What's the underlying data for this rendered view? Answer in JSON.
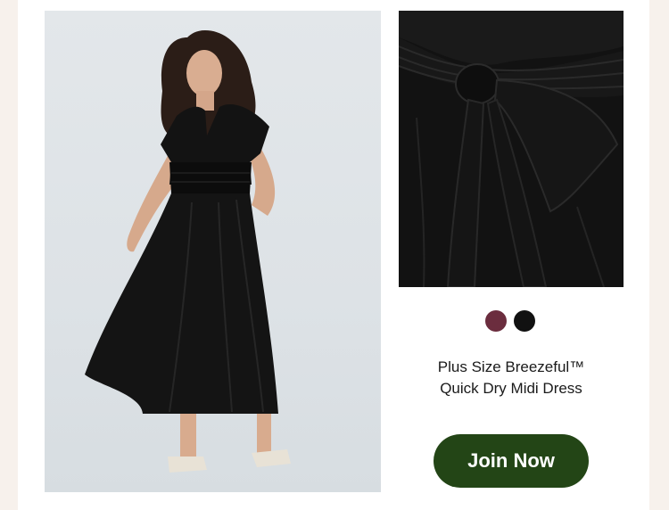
{
  "product": {
    "title_line1": "Plus Size Breezeful™",
    "title_line2": "Quick Dry Midi Dress",
    "main_image_alt": "Model wearing black wrap midi dress",
    "detail_image_alt": "Close-up of tie waist detail"
  },
  "swatches": [
    {
      "name": "burgundy",
      "color": "#6b2d3e"
    },
    {
      "name": "black",
      "color": "#111111"
    }
  ],
  "cta": {
    "label": "Join Now",
    "bg": "#234516"
  },
  "colors": {
    "page_bg": "#f7f1ec",
    "card_bg": "#ffffff"
  }
}
